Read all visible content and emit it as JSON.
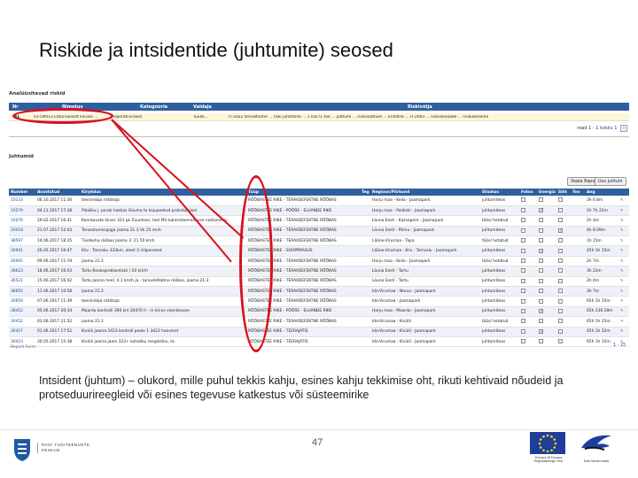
{
  "slide": {
    "title": "Riskide ja intsidentide (juhtumite) seosed",
    "definition": "Intsident (juhtum) – olukord, mille puhul tekkis kahju, esines kahju tekkimise oht, rikuti kehtivaid nõudeid ja protseduurireegleid või esines tegevuse katkestus või süsteemirike",
    "page_number": "47"
  },
  "risk_panel": {
    "title": "Analüüsitavad riskid",
    "columns": [
      "Nr",
      "Nimetus",
      "Kategooria",
      "Valdaja",
      "Riskivõtja"
    ],
    "row": {
      "nr": "31",
      "name": "01-OP013 Ebturvaliselt kiiruse ...",
      "category": "Operatiivriskid",
      "owner": "Tuulik...",
      "details": "IT-2022 kõrvaltoime ... riski juhtimine ... 1 ID271 tee ... juhtumi ... riskivaatluse ... kriitiline ... IT-2003 ... riskiülevaade ... risikülesanne"
    },
    "pager_text": "read 1 - 1",
    "pager_of": "kokku 1"
  },
  "incidents_panel": {
    "title": "Juhtumid",
    "buttons": {
      "view": "Vaata Raport",
      "new": "Uus juhtum"
    },
    "columns": [
      "Number",
      "Avastatud",
      "Kirjeldus",
      "Tüüp",
      "Teg",
      "Regioon/Piirkond",
      "Staatus",
      "Fotos",
      "Energia",
      "Siht",
      "Teo",
      "Aeg",
      ""
    ],
    "rows": [
      {
        "num": "10133",
        "date": "06.10.2017 11:30",
        "desc": "teenindaja ristõtaja",
        "type": "RÖÖBASTEE RIKE - TERAVDEFEKTNE RÖÖBAS",
        "region": "Harju maa - Keila - Jaamapark",
        "status": "juhtumiteos",
        "c1": false,
        "c2": false,
        "c3": false,
        "time": "3h 6.8m"
      },
      {
        "num": "10579",
        "date": "04.11.2017 17:38",
        "desc": "Pikaliku j. perak hakkas liikuma ta kojupeetud prakstumisel",
        "type": "RÖÖBASTEE RIKE - PÖÖRE - ELUANDE RIKE",
        "region": "Harju maa - Paldiski - Jaamapark",
        "status": "juhtumiteos",
        "c1": false,
        "c2": true,
        "c3": false,
        "time": "2h 7h 22m"
      },
      {
        "num": "10070",
        "date": "29.02.2017 16:41",
        "desc": "Keerduvate kiiver 323 pk Zuuetsen, teel M3 Iubimeteenenavse nelkameva",
        "type": "RÖÖBASTEE RIKE - TERAVDEFEKTNE RÖÖBAS",
        "region": "Lõuna Eesti - Kazsepere - Jaamapark",
        "status": "töös/ hetatud",
        "c1": false,
        "c2": false,
        "c3": false,
        "time": "2h 4m"
      },
      {
        "num": "20018",
        "date": "21.07.2017 12:43",
        "desc": "Tarvastumisajaga jaama 21.3 Vk 25 mnh",
        "type": "RÖÖBASTEE RIKE - TERAVDEFEKTNE RÖÖBAS",
        "region": "Lõuna Eesti - Pärnu - Jaamapark",
        "status": "juhtumiteos",
        "c1": false,
        "c2": false,
        "c3": true,
        "time": "4h 8.09m"
      },
      {
        "num": "38597",
        "date": "14.06.2017 18:35",
        "desc": "Tiselkoha rööbas jaama 3: 21 50 kmh",
        "type": "RÖÖBASTEE RIKE - TERAVDEFEKTNE RÖÖBAS",
        "region": "Lääne-Virumaa - Tapa",
        "status": "töös/ hetatud",
        "c1": false,
        "c2": false,
        "c3": false,
        "time": "1h 15m"
      },
      {
        "num": "30001",
        "date": "26.05.2017 16:47",
        "desc": "Kiiv - Tamsalu 333km, oleet 3 riiliperosed",
        "type": "RÖÖBASTEE RIKE - SOOPÄRASUS",
        "region": "Lääne-Virumaa - Kiiv - Tamsalu - Jaamapark",
        "status": "juhtumiteos",
        "c1": false,
        "c2": true,
        "c3": false,
        "time": "45h 1h 15m"
      },
      {
        "num": "20002",
        "date": "09.06.2017 11:19",
        "desc": "jaama 21.2",
        "type": "RÖÖBASTEE RIKE - TERAVDEFEKTNE RÖÖBAS",
        "region": "Harju maa - Keila - Jaamapark",
        "status": "töös/ hetatud",
        "c1": false,
        "c2": false,
        "c3": false,
        "time": "2h 7m"
      },
      {
        "num": "38623",
        "date": "18.06.2017 16:43",
        "desc": "Tartu-Rooksprokkontaks / 20 km/h",
        "type": "RÖÖBASTEE RIKE - TERAVDEFEKTNE RÖÖBAS",
        "region": "Lõuna Eesti - Tartu",
        "status": "juhtumiteos",
        "c1": false,
        "c2": false,
        "c3": false,
        "time": "3h 22m"
      },
      {
        "num": "36521",
        "date": "15.06.2017 16:42",
        "desc": "Tartu jaama heel, 4.1 km/h ja - taravdefektne rööbas, jaama 21.3",
        "type": "RÖÖBASTEE RIKE - TERAVDEFEKTNE RÖÖBAS",
        "region": "Lõuna Eesti - Tartu",
        "status": "juhtumiteos",
        "c1": false,
        "c2": false,
        "c3": false,
        "time": "2h 4m"
      },
      {
        "num": "38655",
        "date": "11.06.2017 10:58",
        "desc": "jaama 21.2",
        "type": "RÖÖBASTEE RIKE - TERAVDEFEKTNE RÖÖBAS",
        "region": "Ida-Virumaa - Narva - Jaamapark",
        "status": "juhtumiteos",
        "c1": false,
        "c2": false,
        "c3": false,
        "time": "3h 7m"
      },
      {
        "num": "30650",
        "date": "07.06.2017 11:39",
        "desc": "teenindaja ristõtaja",
        "type": "RÖÖBASTEE RIKE - TERAVDEFEKTNE RÖÖBAS",
        "region": "Ida-Virumaa - Jaamapark",
        "status": "juhtumiteos",
        "c1": false,
        "c2": false,
        "c3": false,
        "time": "65h 1h 15m"
      },
      {
        "num": "38452",
        "date": "05.06.2017 20:34",
        "desc": "Maardu kontrolli 390 km 20470 h - in kiirus võenkkusse",
        "type": "RÖÖBASTEE RIKE - PÖÖRE - ELUANDE RIKE",
        "region": "Harju maa - Maardu - Jaamapark",
        "status": "juhtumiteos",
        "c1": false,
        "c2": true,
        "c3": false,
        "time": "65h 238 28m"
      },
      {
        "num": "30452",
        "date": "03.06.2017 21:52",
        "desc": "jaama 21.2",
        "type": "RÖÖBASTEE RIKE - TERAVDEFEKTNE RÖÖBAS",
        "region": "Ida-Virumaa - Kiviõli",
        "status": "töös/ hetatud",
        "c1": false,
        "c2": false,
        "c3": false,
        "time": "65h 1h 15m"
      },
      {
        "num": "30457",
        "date": "01.06.2017 17:52",
        "desc": "Kiviõli jaama 3413 kontroll peale 1 3423 hoovmel",
        "type": "RÖÖBASTEE RIKE - TEERAJATIS",
        "region": "Ida-Virumaa - Kiviõli - Jaamapark",
        "status": "juhtumiteos",
        "c1": false,
        "c2": true,
        "c3": false,
        "time": "45h 1h 22m"
      },
      {
        "num": "30423",
        "date": "30.05.2017 15:38",
        "desc": "Kiviõli jaama jaam 323+ kohaliku reeglistiku, ta",
        "type": "RÖÖBASTEE RIKE - TEERAJATIS",
        "region": "Ida-Virumaa - Kiviõli - Jaamapark",
        "status": "juhtumiteos",
        "c1": false,
        "c2": false,
        "c3": false,
        "time": "65h 1h 15m"
      }
    ],
    "pager": "1 - 15",
    "export": "Report Form"
  },
  "logos": {
    "left_line1": "RIIGI TUGITEENUSTE",
    "left_line2": "KESKUS",
    "eu_caption": "Euroopa Liit Euroopa Regionaalarengu Fond",
    "ee_caption": "Eesti tuleviku heaks"
  },
  "colors": {
    "header_blue": "#2f5f9e",
    "annotation_red": "#d6121f",
    "highlight_row": "#fff6d8",
    "eu_blue": "#1f3e9a"
  }
}
